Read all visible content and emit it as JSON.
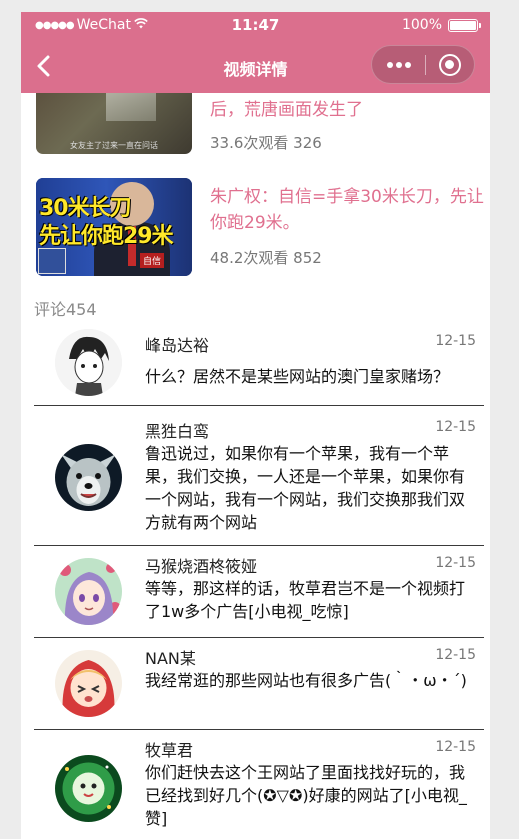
{
  "status_bar": {
    "carrier": "WeChat",
    "time": "11:47",
    "battery": "100%"
  },
  "nav": {
    "title": "视频详情",
    "back_icon": "chevron-left-icon",
    "more_icon": "more-dots-icon",
    "close_icon": "target-circle-icon"
  },
  "videos": [
    {
      "title": "后，荒唐画面发生了",
      "meta": "33.6次观看 326",
      "thumb_caption": "女友主了过来一直在问话"
    },
    {
      "title": "朱广权：自信=手拿30米长刀，先让你跑29米。",
      "meta": "48.2次观看 852",
      "thumb_line1": "30米长刀",
      "thumb_line2": "先让你跑29米",
      "thumb_badge": "自信"
    }
  ],
  "comments_header": "评论454",
  "comments": [
    {
      "name": "峰岛达裕",
      "date": "12-15",
      "text": "什么？居然不是某些网站的澳门皇家赌场？"
    },
    {
      "name": "黑狌白鸾",
      "date": "12-15",
      "text": "鲁迅说过，如果你有一个苹果，我有一个苹果，我们交换，一人还是一个苹果，如果你有一个网站，我有一个网站，我们交换那我们双方就有两个网站"
    },
    {
      "name": "马猴烧酒柊筱娅",
      "date": "12-15",
      "text": "等等，那这样的话，牧草君岂不是一个视频打了1w多个广告[小电视_吃惊]"
    },
    {
      "name": "NAN某",
      "date": "12-15",
      "text": "我经常逛的那些网站也有很多广告(｀・ω・´)"
    },
    {
      "name": "牧草君",
      "date": "12-15",
      "text": "你们赶快去这个王网站了里面找找好玩的，我已经找到好几个(✪▽✪)好康的网站了[小电视_赞]"
    }
  ],
  "colors": {
    "brand": "#db6f8d",
    "title_pink": "#e0708f"
  }
}
